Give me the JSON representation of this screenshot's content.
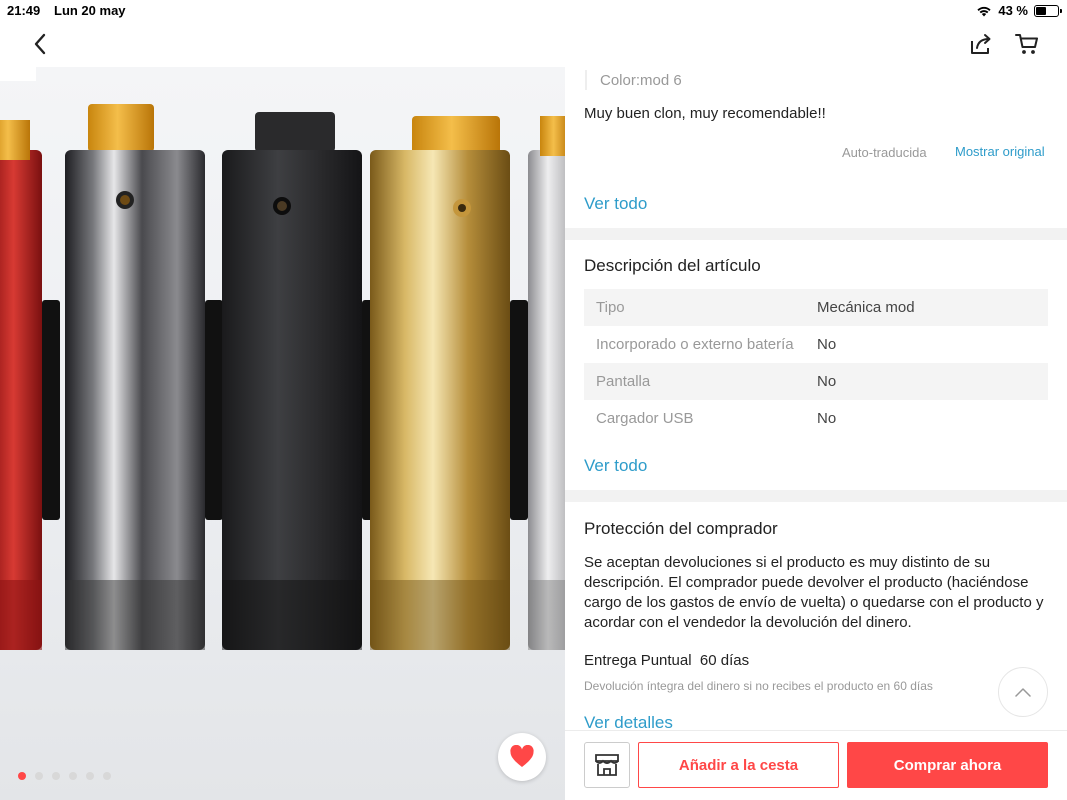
{
  "status_bar": {
    "time": "21:49",
    "date": "Lun 20 may",
    "battery": "43 %",
    "battery_level": 0.43
  },
  "nav": {
    "back_icon": "chevron-left-icon",
    "share_icon": "share-icon",
    "cart_icon": "cart-icon"
  },
  "gallery": {
    "dot_count": 6,
    "active_index": 0,
    "favorite_icon": "heart-icon",
    "accent": "#ff4747"
  },
  "review": {
    "color": "Color:mod 6",
    "text": "Muy buen clon, muy recomendable!!",
    "auto_translated": "Auto-traducida",
    "show_original": "Mostrar original",
    "see_all": "Ver todo"
  },
  "description": {
    "title": "Descripción del artículo",
    "specs": [
      {
        "key": "Tipo",
        "value": "Mecánica mod"
      },
      {
        "key": "Incorporado o externo batería",
        "value": "No"
      },
      {
        "key": "Pantalla",
        "value": "No"
      },
      {
        "key": "Cargador USB",
        "value": "No"
      }
    ],
    "see_all": "Ver todo"
  },
  "protection": {
    "title": "Protección del comprador",
    "text": "Se aceptan devoluciones si el producto es muy distinto de su descripción. El comprador puede devolver el producto (haciéndose cargo de los gastos de envío de vuelta) o quedarse con el producto y acordar con el vendedor la devolución del dinero.",
    "delivery": "Entrega Puntual  60 días",
    "delivery_note": "Devolución íntegra del dinero si no recibes el producto en 60 días",
    "see_details": "Ver detalles"
  },
  "bottom_bar": {
    "store_icon": "store-icon",
    "add_to_cart": "Añadir a la cesta",
    "buy_now": "Comprar ahora"
  }
}
